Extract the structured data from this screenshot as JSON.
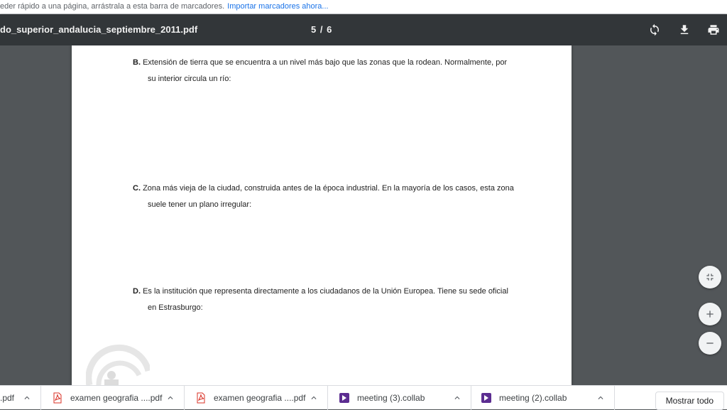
{
  "bookmarks_bar": {
    "text": "eder rápido a una página, arrástrala a esta barra de marcadores.",
    "import_link": "Importar marcadores ahora..."
  },
  "toolbar": {
    "title": "do_superior_andalucia_septiembre_2011.pdf",
    "page_indicator": "5 / 6",
    "icons": [
      "rotate-icon",
      "download-icon",
      "print-icon"
    ]
  },
  "document": {
    "questions": [
      {
        "letter": "B.",
        "line1": "Extensión de tierra que se encuentra a un nivel más bajo que las zonas que la rodean. Normalmente, por",
        "line2": "su interior circula un río:"
      },
      {
        "letter": "C.",
        "line1": "Zona más vieja de la ciudad, construida antes de la época industrial. En la mayoría de los casos, esta zona",
        "line2": "suele tener un plano irregular:"
      },
      {
        "letter": "D.",
        "line1": "Es la institución que representa directamente a los ciudadanos de la Unión Europea. Tiene su sede oficial",
        "line2": "en Estrasburgo:"
      }
    ]
  },
  "zoom_controls": [
    "fit-page-icon",
    "zoom-in-icon",
    "zoom-out-icon"
  ],
  "downloads": {
    "items": [
      {
        "name": ".pdf",
        "type": "pdf"
      },
      {
        "name": "examen geografia ....pdf",
        "type": "pdf"
      },
      {
        "name": "examen geografia ....pdf",
        "type": "pdf"
      },
      {
        "name": "meeting (3).collab",
        "type": "collab"
      },
      {
        "name": "meeting (2).collab",
        "type": "collab"
      }
    ],
    "show_all": "Mostrar todo"
  },
  "colors": {
    "toolbar_bg": "#323639",
    "viewer_bg": "#525659",
    "link": "#1a73e8",
    "pdf_icon": "#d93025",
    "collab_icon": "#5c2d91"
  }
}
